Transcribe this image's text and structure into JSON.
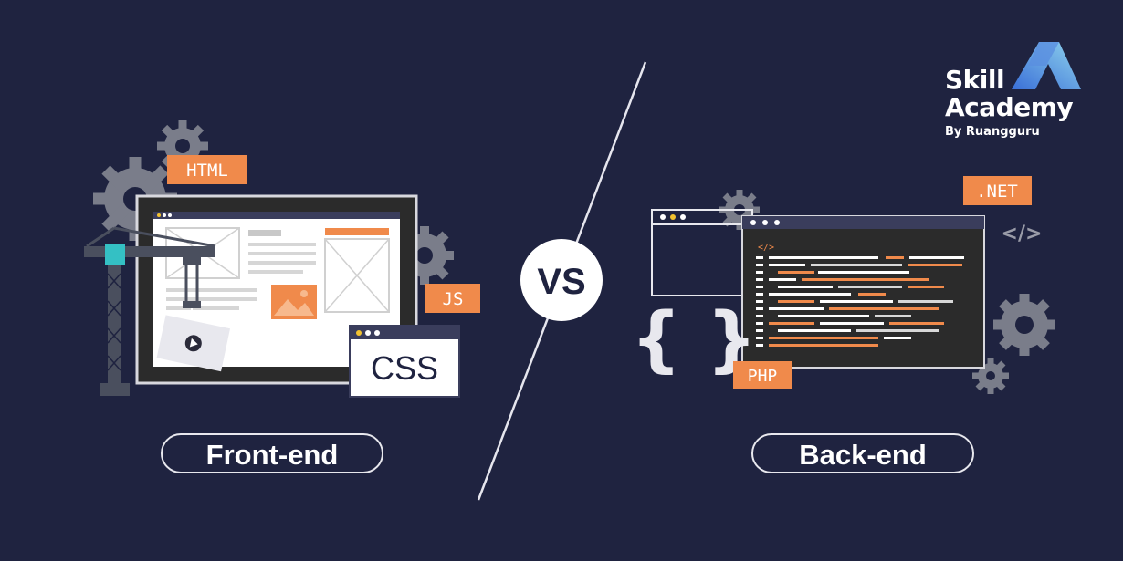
{
  "brand": {
    "line1": "Skill",
    "line2": "Academy",
    "line3": "By Ruangguru",
    "color": "#ffffff",
    "logo_gradient": [
      "#3a6fd8",
      "#8fd3ec"
    ]
  },
  "vs_label": "VS",
  "frontend": {
    "label": "Front-end",
    "tags": {
      "html": "HTML",
      "js": "JS",
      "css": "CSS"
    }
  },
  "backend": {
    "label": "Back-end",
    "tags": {
      "net": ".NET",
      "php": "PHP"
    },
    "code_tag": "</>",
    "braces": "{ }",
    "code_header": "</>"
  },
  "colors": {
    "background": "#1f2340",
    "accent_orange": "#f08a4b",
    "gear_gray": "#7a7d8a",
    "screen_dark": "#2b2b2b",
    "white": "#ffffff"
  }
}
